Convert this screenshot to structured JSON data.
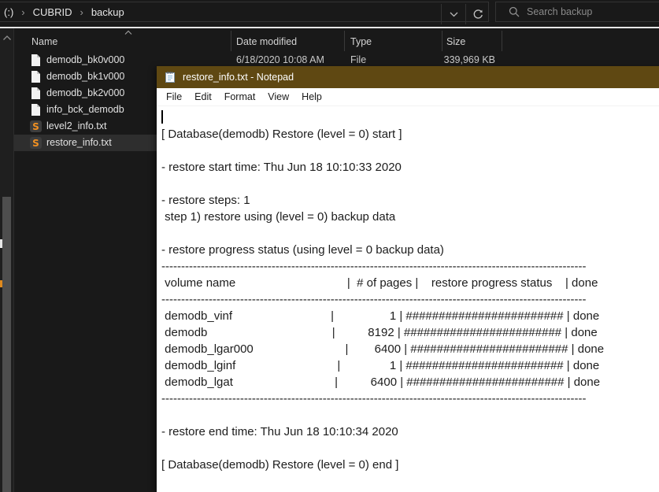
{
  "explorer": {
    "breadcrumb": {
      "drive": "(:)",
      "items": [
        "CUBRID",
        "backup"
      ]
    },
    "toolbar": {
      "search_placeholder": "Search backup"
    },
    "columns": {
      "name": "Name",
      "date": "Date modified",
      "type": "Type",
      "size": "Size"
    },
    "files": [
      {
        "name": "demodb_bk0v000",
        "icon": "file",
        "date": "6/18/2020 10:08 AM",
        "type": "File",
        "size": "339,969 KB"
      },
      {
        "name": "demodb_bk1v000",
        "icon": "file"
      },
      {
        "name": "demodb_bk2v000",
        "icon": "file"
      },
      {
        "name": "info_bck_demodb",
        "icon": "file"
      },
      {
        "name": "level2_info.txt",
        "icon": "sublime-text",
        "glyph": "S"
      },
      {
        "name": "restore_info.txt",
        "icon": "sublime-text",
        "glyph": "S",
        "selected": true
      }
    ],
    "colors": {
      "background": "#191919",
      "selection": "#2e2e2e",
      "divider": "#e6e6e6",
      "sublime_orange": "#f19021"
    }
  },
  "notepad": {
    "title": "restore_info.txt - Notepad",
    "menus": [
      "File",
      "Edit",
      "Format",
      "View",
      "Help"
    ],
    "title_bar_color": "#5f4812",
    "text_lines": [
      "",
      "[ Database(demodb) Restore (level = 0) start ]",
      "",
      "- restore start time: Thu Jun 18 10:10:33 2020",
      "",
      "- restore steps: 1",
      " step 1) restore using (level = 0) backup data",
      "",
      "- restore progress status (using level = 0 backup data)",
      "------------------------------------------------------------------------------------------------------------",
      " volume name                                  |  # of pages |    restore progress status    | done",
      "------------------------------------------------------------------------------------------------------------",
      " demodb_vinf                              |                 1 | ######################## | done",
      " demodb                                      |          8192 | ######################## | done",
      " demodb_lgar000                            |        6400 | ######################## | done",
      " demodb_lginf                               |               1 | ######################## | done",
      " demodb_lgat                               |          6400 | ######################## | done",
      "------------------------------------------------------------------------------------------------------------",
      "",
      "- restore end time: Thu Jun 18 10:10:34 2020",
      "",
      "[ Database(demodb) Restore (level = 0) end ]"
    ]
  }
}
